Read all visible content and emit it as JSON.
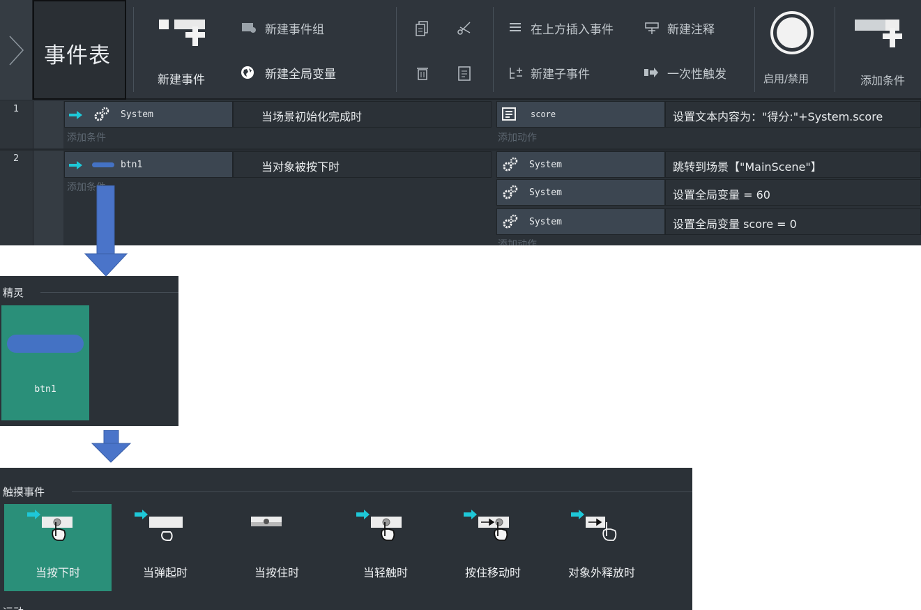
{
  "toolbar": {
    "title": "事件表",
    "new_event": "新建事件",
    "new_event_group": "新建事件组",
    "new_global_var": "新建全局变量",
    "insert_above": "在上方插入事件",
    "new_sub_event": "新建子事件",
    "new_comment": "新建注释",
    "trigger_once": "一次性触发",
    "enable_disable": "启用/禁用",
    "add_condition": "添加条件"
  },
  "events": [
    {
      "number": "1",
      "condition_object": "System",
      "condition_text": "当场景初始化完成时",
      "add_condition": "添加条件",
      "actions": [
        {
          "object": "score",
          "text": "设置文本内容为：\"得分:\"+System.score"
        }
      ],
      "add_action": "添加动作"
    },
    {
      "number": "2",
      "condition_object": "btn1",
      "condition_text": "当对象被按下时",
      "add_condition": "添加条件",
      "actions": [
        {
          "object": "System",
          "text": "跳转到场景【\"MainScene\"】"
        },
        {
          "object": "System",
          "text": "设置全局变量  = 60"
        },
        {
          "object": "System",
          "text": "设置全局变量 score = 0"
        }
      ],
      "add_action": "添加动作"
    }
  ],
  "sprite_panel": {
    "title": "精灵",
    "sprite_name": "btn1"
  },
  "touch_panel": {
    "title": "触摸事件",
    "items": [
      {
        "label": "当按下时",
        "selected": true
      },
      {
        "label": "当弹起时",
        "selected": false
      },
      {
        "label": "当按住时",
        "selected": false
      },
      {
        "label": "当轻触时",
        "selected": false
      },
      {
        "label": "按住移动时",
        "selected": false
      },
      {
        "label": "对象外释放时",
        "selected": false
      }
    ],
    "next_section": "运动"
  },
  "colors": {
    "selected": "#2a8f79",
    "object_cell": "#3c4651",
    "cyan_arrow": "#1ec8d8",
    "button_blue": "#4472c4",
    "flow_arrow": "#4a74c9"
  }
}
